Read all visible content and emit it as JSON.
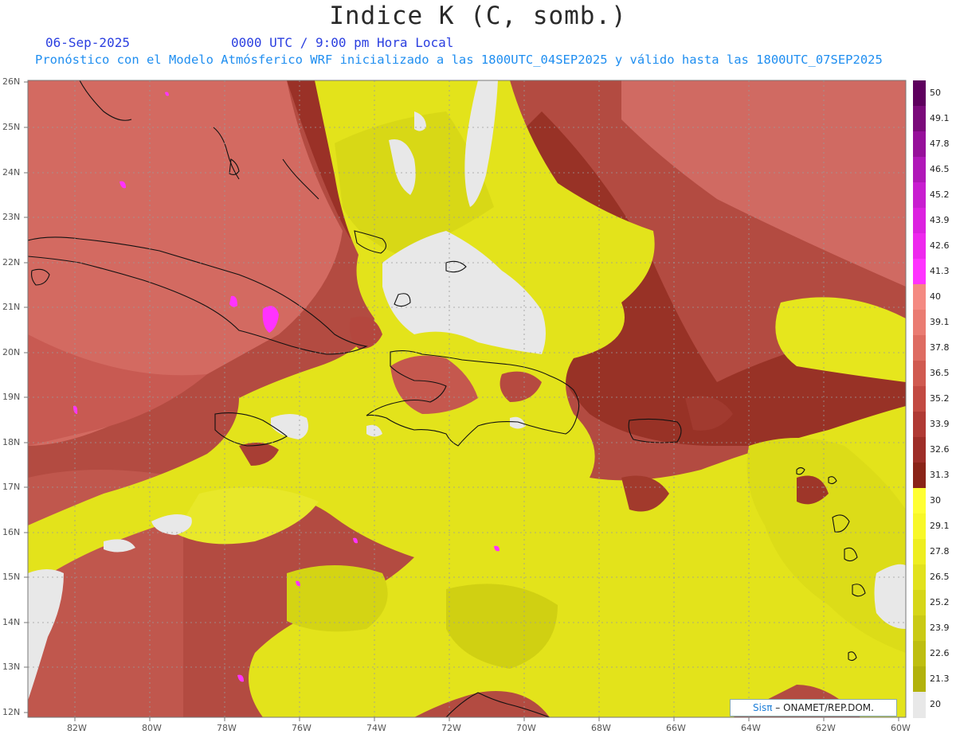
{
  "header": {
    "title": "Indice K (C, somb.)",
    "date": "06-Sep-2025",
    "time": "0000 UTC / 9:00 pm Hora Local",
    "forecast_line": "Pronóstico con el Modelo Atmósferico WRF inicializado a las 1800UTC_04SEP2025 y válido hasta las  1800UTC_07SEP2025"
  },
  "map": {
    "lat_labels": [
      "26N",
      "25N",
      "24N",
      "23N",
      "22N",
      "21N",
      "20N",
      "19N",
      "18N",
      "17N",
      "16N",
      "15N",
      "14N",
      "13N",
      "12N"
    ],
    "lon_labels": [
      "82W",
      "80W",
      "78W",
      "76W",
      "74W",
      "72W",
      "70W",
      "68W",
      "66W",
      "64W",
      "62W",
      "60W"
    ]
  },
  "colorbar": {
    "labels": [
      "50",
      "49.1",
      "47.8",
      "46.5",
      "45.2",
      "43.9",
      "42.6",
      "41.3",
      "40",
      "39.1",
      "37.8",
      "36.5",
      "35.2",
      "33.9",
      "32.6",
      "31.3",
      "30",
      "29.1",
      "27.8",
      "26.5",
      "25.2",
      "23.9",
      "22.6",
      "21.3",
      "20"
    ],
    "colors": [
      "#5e005e",
      "#7a0a7a",
      "#96109a",
      "#b018b8",
      "#c81ed0",
      "#dc22e0",
      "#ee28ee",
      "#ff33ff",
      "#f48a82",
      "#ea7c72",
      "#de6c62",
      "#d05a50",
      "#c24a42",
      "#b03a34",
      "#9e2e28",
      "#8a2418",
      "#ffff33",
      "#f8f828",
      "#eeee20",
      "#e2e21c",
      "#d6d618",
      "#caca14",
      "#bebe10",
      "#b2b20c",
      "#e8e8e8"
    ]
  },
  "credit": {
    "brand": "Sisπ",
    "text": "– ONAMET/REP.DOM."
  }
}
